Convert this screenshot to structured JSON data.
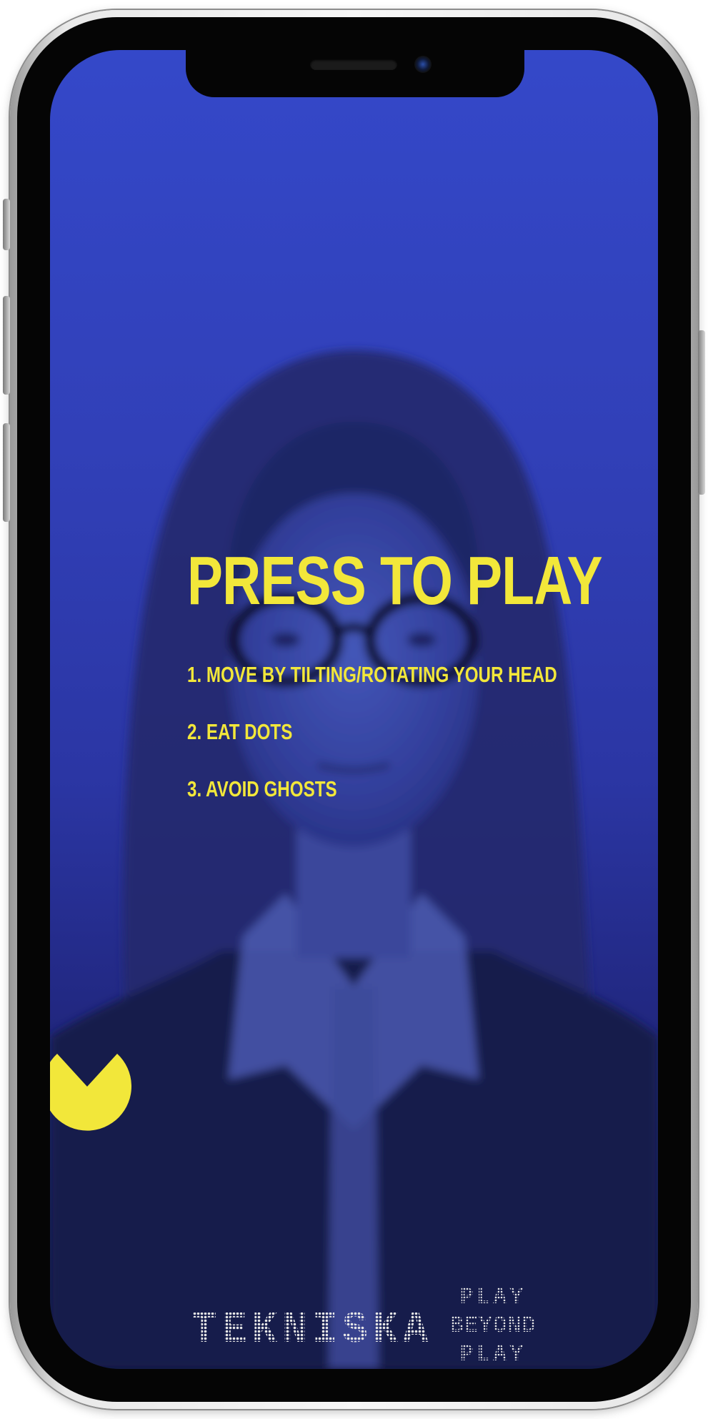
{
  "game": {
    "title": "PRESS TO PLAY",
    "instructions": [
      "1. MOVE BY TILTING/ROTATING YOUR HEAD",
      "2. EAT DOTS",
      "3. AVOID GHOSTS"
    ],
    "player_icon": "pacman-icon"
  },
  "branding": {
    "logo_text": "TEKNISKA",
    "tagline": [
      "PLAY",
      "BEYOND",
      "PLAY"
    ]
  },
  "colors": {
    "accent_yellow": "#f2e73a",
    "overlay_blue": "#3448c9"
  }
}
